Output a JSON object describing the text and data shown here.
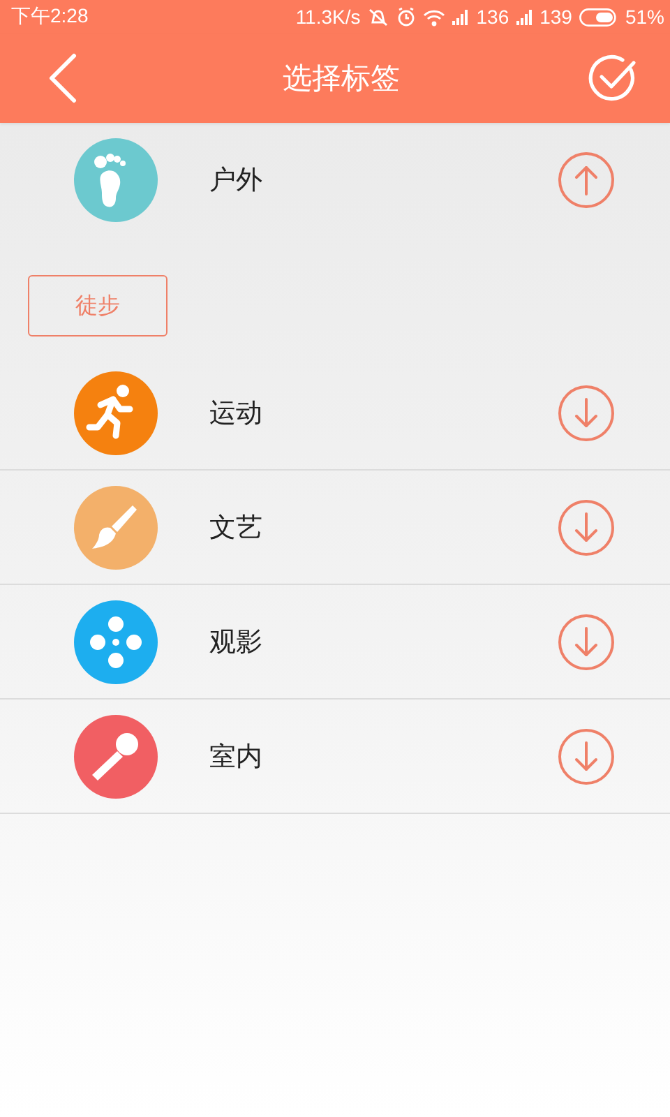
{
  "status_bar": {
    "time": "下午2:28",
    "speed": "11.3K/s",
    "sim1": "136",
    "sim2": "139",
    "battery": "51%"
  },
  "nav": {
    "title": "选择标签"
  },
  "categories": [
    {
      "label": "户外",
      "kind": "foot",
      "color": "#6cc9cf",
      "expanded": true,
      "tags": [
        {
          "label": "徒步"
        }
      ]
    },
    {
      "label": "运动",
      "kind": "runner",
      "color": "#f5810f",
      "expanded": false
    },
    {
      "label": "文艺",
      "kind": "brush",
      "color": "#f3b06a",
      "expanded": false
    },
    {
      "label": "观影",
      "kind": "film",
      "color": "#1daeef",
      "expanded": false
    },
    {
      "label": "室内",
      "kind": "mic",
      "color": "#f15f63",
      "expanded": false
    }
  ]
}
